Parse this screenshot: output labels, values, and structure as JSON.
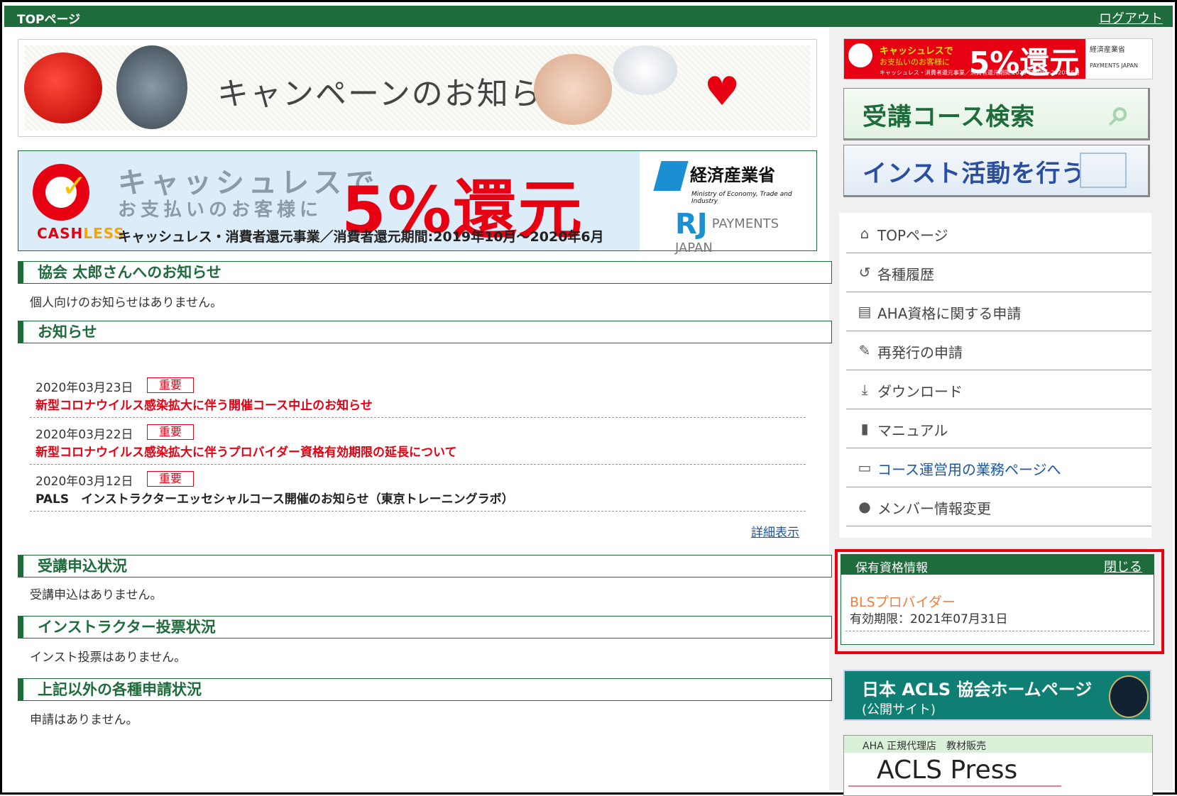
{
  "header": {
    "title": "TOPページ",
    "logout": "ログアウト"
  },
  "banners": {
    "campaign": "キャンペーンのお知らせ",
    "cashless": {
      "line1": "キャッシュレスで",
      "line2": "お支払いのお客様に",
      "big": "5%還元",
      "sub": "キャッシュレス・消費者還元事業／消費者還元期間:2019年10月〜2020年6月",
      "brand_a": "CASH",
      "brand_b": "LESS",
      "meti": "経済産業省",
      "meti_en": "Ministry of Economy, Trade and Industry",
      "pj_rj": "RJ",
      "pj": "PAYMENTS JAPAN"
    }
  },
  "sections": {
    "personal": {
      "title": "協会 太郎さんへのお知らせ",
      "empty": "個人向けのお知らせはありません。"
    },
    "notices": {
      "title": "お知らせ",
      "items": [
        {
          "date": "2020年03月23日",
          "badge": "重要",
          "title": "新型コロナウイルス感染拡大に伴う開催コース中止のお知らせ"
        },
        {
          "date": "2020年03月22日",
          "badge": "重要",
          "title": "新型コロナウイルス感染拡大に伴うプロバイダー資格有効期限の延長について"
        },
        {
          "date": "2020年03月12日",
          "badge": "重要",
          "title": "PALS　インストラクターエッセシャルコース開催のお知らせ（東京トレーニングラボ）"
        }
      ],
      "more": "詳細表示"
    },
    "course_app": {
      "title": "受講申込状況",
      "empty": "受講申込はありません。"
    },
    "instructor_vote": {
      "title": "インストラクター投票状況",
      "empty": "インスト投票はありません。"
    },
    "other_app": {
      "title": "上記以外の各種申請状況",
      "empty": "申請はありません。"
    }
  },
  "sidebar": {
    "mini_cashless": {
      "line1": "キャッシュレスで",
      "line2": "お支払いのお客様に",
      "big": "5%還元",
      "sub": "キャッシュレス・消費者還元事業／消費者還元期間:2019年10月〜2020年6月",
      "meti": "経済産業省",
      "pj": "PAYMENTS JAPAN"
    },
    "course_search": "受講コース検索",
    "instructor_activity": "インスト活動を行う",
    "nav": [
      {
        "label": "TOPページ",
        "icon": "home-icon"
      },
      {
        "label": "各種履歴",
        "icon": "history-icon"
      },
      {
        "label": "AHA資格に関する申請",
        "icon": "id-card-icon"
      },
      {
        "label": "再発行の申請",
        "icon": "edit-icon"
      },
      {
        "label": "ダウンロード",
        "icon": "download-icon"
      },
      {
        "label": "マニュアル",
        "icon": "book-icon"
      },
      {
        "label": "コース運営用の業務ページへ",
        "icon": "monitor-icon"
      },
      {
        "label": "メンバー情報変更",
        "icon": "user-icon"
      }
    ],
    "qualification": {
      "title": "保有資格情報",
      "close": "閉じる",
      "name": "BLSプロバイダー",
      "expiry": "有効期限：2021年07月31日"
    },
    "acls_home": {
      "title": "日本 ACLS 協会ホームページ",
      "sub": "(公開サイト)"
    },
    "acls_press": {
      "header": "AHA 正規代理店　教材販売",
      "logo": "ACLS Press"
    }
  }
}
